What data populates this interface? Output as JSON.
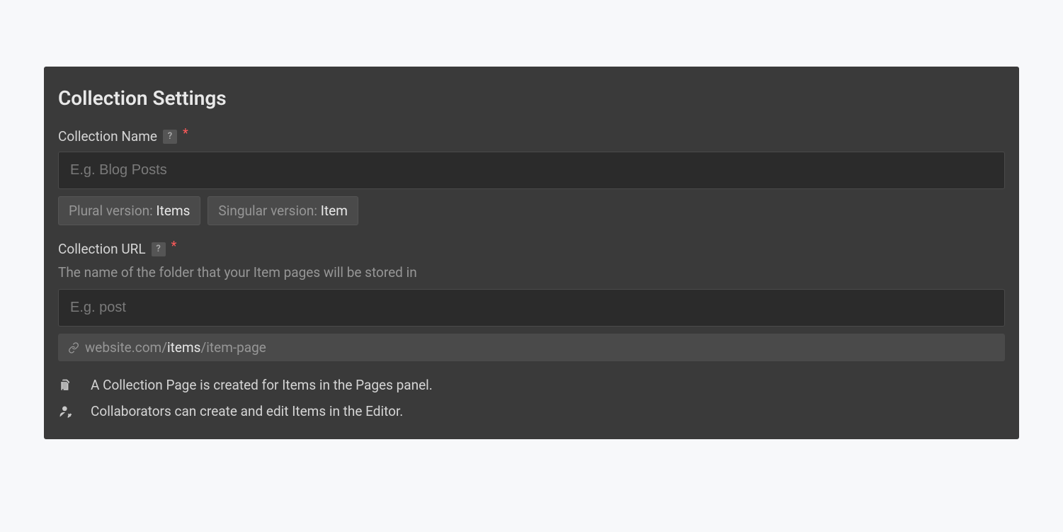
{
  "panel": {
    "title": "Collection Settings"
  },
  "name_field": {
    "label": "Collection Name",
    "help_glyph": "?",
    "required_glyph": "*",
    "placeholder": "E.g. Blog Posts",
    "value": "",
    "plural_chip_label": "Plural version: ",
    "plural_chip_value": "Items",
    "singular_chip_label": "Singular version: ",
    "singular_chip_value": "Item"
  },
  "url_field": {
    "label": "Collection URL",
    "help_glyph": "?",
    "required_glyph": "*",
    "hint": "The name of the folder that your Item pages will be stored in",
    "placeholder": "E.g. post",
    "value": "",
    "preview_prefix": "website.com/",
    "preview_slug": "items",
    "preview_suffix": "/item-page"
  },
  "info": {
    "line1": "A Collection Page is created for Items in the Pages panel.",
    "line2": "Collaborators can create and edit Items in the Editor."
  },
  "colors": {
    "required_star": "#ff5a5a"
  }
}
